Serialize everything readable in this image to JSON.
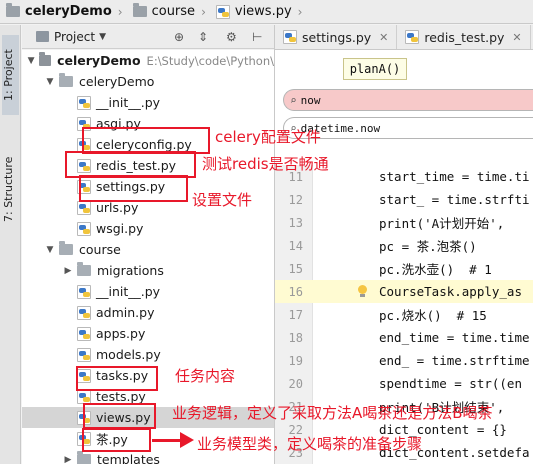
{
  "breadcrumb": {
    "items": [
      {
        "label": "celeryDemo",
        "icon": "folder-icon",
        "bold": true
      },
      {
        "label": "course",
        "icon": "folder-icon",
        "bold": false
      },
      {
        "label": "views.py",
        "icon": "python-file-icon",
        "bold": false
      }
    ],
    "separator": "›"
  },
  "toolstrip": {
    "project_tab": "1: Project",
    "structure_tab": "7: Structure"
  },
  "project_panel": {
    "title": "Project",
    "dropdown_icon": "triangle-down-icon",
    "header_icons": [
      "target-icon",
      "collapse-icon",
      "gear-icon",
      "hide-icon"
    ]
  },
  "tree": [
    {
      "label": "celeryDemo",
      "type": "folder",
      "expanded": true,
      "bold": true,
      "path": "E:\\Study\\code\\Python\\"
    },
    {
      "label": "celeryDemo",
      "type": "folder",
      "expanded": true
    },
    {
      "label": "__init__.py",
      "type": "file"
    },
    {
      "label": "asgi.py",
      "type": "file"
    },
    {
      "label": "celeryconfig.py",
      "type": "file"
    },
    {
      "label": "redis_test.py",
      "type": "file"
    },
    {
      "label": "settings.py",
      "type": "file"
    },
    {
      "label": "urls.py",
      "type": "file"
    },
    {
      "label": "wsgi.py",
      "type": "file"
    },
    {
      "label": "course",
      "type": "folder",
      "expanded": true
    },
    {
      "label": "migrations",
      "type": "folder",
      "expanded": false
    },
    {
      "label": "__init__.py",
      "type": "file"
    },
    {
      "label": "admin.py",
      "type": "file"
    },
    {
      "label": "apps.py",
      "type": "file"
    },
    {
      "label": "models.py",
      "type": "file"
    },
    {
      "label": "tasks.py",
      "type": "file"
    },
    {
      "label": "tests.py",
      "type": "file"
    },
    {
      "label": "views.py",
      "type": "file",
      "selected": true
    },
    {
      "label": "茶.py",
      "type": "file"
    },
    {
      "label": "templates",
      "type": "folder",
      "expanded": false
    }
  ],
  "editor": {
    "tabs": [
      {
        "label": "settings.py"
      },
      {
        "label": "redis_test.py"
      }
    ],
    "param_popup": "planA()",
    "search_rows": [
      {
        "value": "now",
        "state": "error"
      },
      {
        "value": "datetime.now",
        "state": "normal"
      }
    ],
    "lines": [
      {
        "number": "11",
        "text": "start_time = time.ti"
      },
      {
        "number": "12",
        "text": "start_ = time.strfti"
      },
      {
        "number": "13",
        "text": "print('A计划开始',"
      },
      {
        "number": "14",
        "text": "pc = 茶.泡茶()"
      },
      {
        "number": "15",
        "text": "pc.洗水壶()  # 1"
      },
      {
        "number": "16",
        "text": "CourseTask.apply_as",
        "highlight": true,
        "bulb": true
      },
      {
        "number": "17",
        "text": "pc.烧水()  # 15"
      },
      {
        "number": "18",
        "text": "end_time = time.time"
      },
      {
        "number": "19",
        "text": "end_ = time.strftime"
      },
      {
        "number": "20",
        "text": "spendtime = str((en"
      },
      {
        "number": "21",
        "text": "print('B计划结束',"
      },
      {
        "number": "22",
        "text": "dict_content = {}"
      },
      {
        "number": "23",
        "text": "dict_content.setdefa"
      }
    ]
  },
  "annotations": {
    "celeryconfig_note": "celery配置文件",
    "redis_test_note": "测试redis是否畅通",
    "settings_note": "设置文件",
    "tasks_note": "任务内容",
    "views_note": "业务逻辑，定义了采取方法A喝茶还是方法B喝茶",
    "tea_note": "业务模型类，定义喝茶的准备步骤",
    "color": "#e8182a"
  }
}
